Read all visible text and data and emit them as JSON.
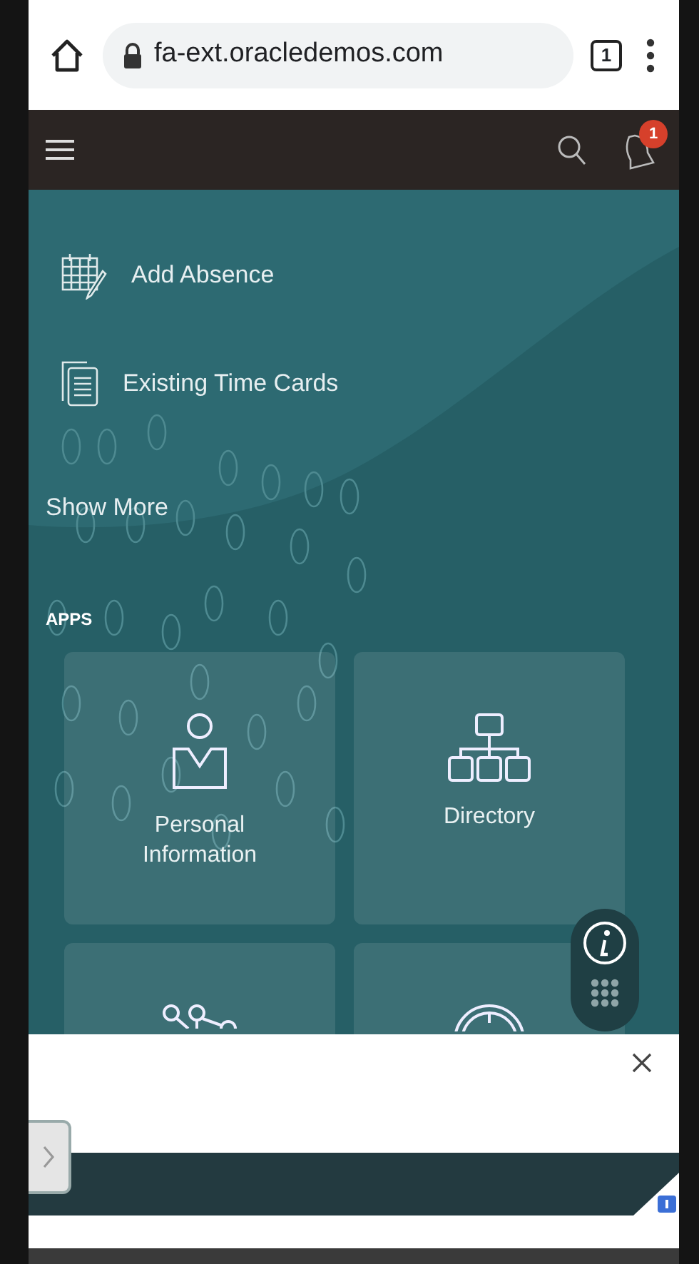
{
  "browser": {
    "url": "fa-ext.oracledemos.com",
    "tab_count": "1"
  },
  "header": {
    "notification_count": "1"
  },
  "quick_actions": [
    {
      "label": "Add Absence",
      "kind": "calendar"
    },
    {
      "label": "Existing Time Cards",
      "kind": "documents"
    }
  ],
  "show_more": "Show More",
  "apps": {
    "heading": "APPS",
    "tiles": [
      {
        "label": "Personal Information",
        "kind": "person"
      },
      {
        "label": "Directory",
        "kind": "org"
      },
      {
        "kind": "network"
      },
      {
        "kind": "clock"
      }
    ]
  }
}
